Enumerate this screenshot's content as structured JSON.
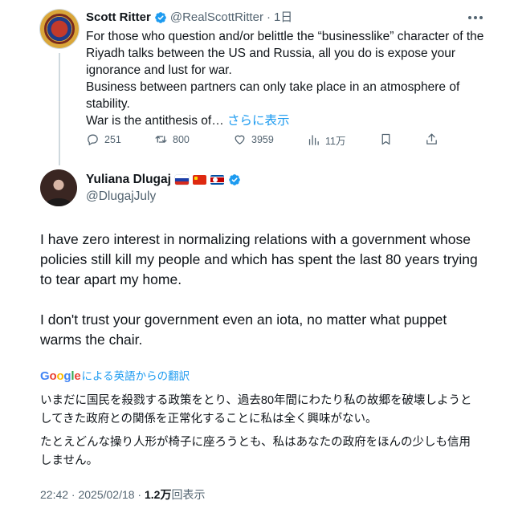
{
  "parent_tweet": {
    "author_name": "Scott Ritter",
    "handle": "@RealScottRitter",
    "separator": "·",
    "time": "1日",
    "text_lines": [
      "For those who question and/or belittle the “businesslike” character of the Riyadh talks between the US and Russia, all you do is expose your ignorance and lust for war.",
      "Business between partners can only take place in an atmosphere of stability."
    ],
    "text_truncated": "War is the antithesis of…",
    "show_more_label": "さらに表示",
    "actions": {
      "replies": "251",
      "reposts": "800",
      "likes": "3959",
      "views": "11万"
    }
  },
  "main_tweet": {
    "author_name": "Yuliana Dlugaj",
    "flags": [
      "russia-flag",
      "china-flag",
      "north-korea-flag"
    ],
    "handle": "@DlugajJuly",
    "paragraphs": [
      "I have zero interest in normalizing relations with a government whose policies still kill my people and which has spent the last 80 years trying to tear apart my home.",
      "I don't trust your government even an iota, no matter what puppet warms the chair."
    ],
    "translation": {
      "google_letters": [
        "G",
        "o",
        "o",
        "g",
        "l",
        "e"
      ],
      "label": "による英語からの翻訳",
      "paragraphs": [
        "いまだに国民を殺戮する政策をとり、過去80年間にわたり私の故郷を破壊しようとしてきた政府との関係を正常化することに私は全く興味がない。",
        "たとえどんな操り人形が椅子に座ろうとも、私はあなたの政府をほんの少しも信用しません。"
      ]
    },
    "timestamp": "22:42 · 2025/02/18 · ",
    "views_count": "1.2万",
    "views_label": "回表示"
  },
  "colors": {
    "accent": "#1d9bf0",
    "text": "#0f1419",
    "secondary": "#536471"
  }
}
